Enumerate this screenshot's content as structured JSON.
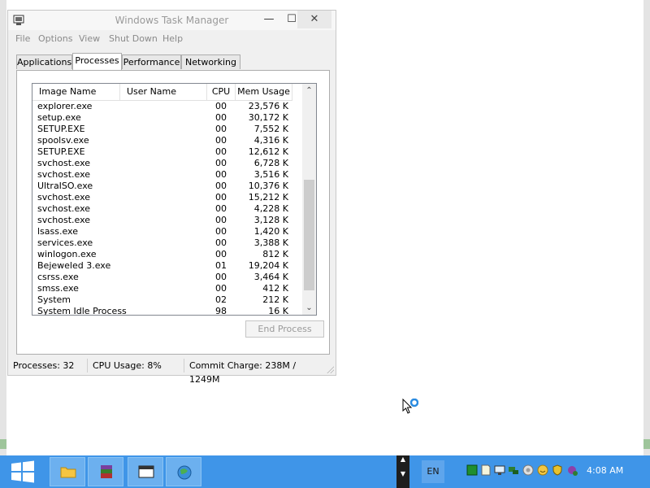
{
  "window": {
    "title": "Windows Task Manager",
    "controls": {
      "minimize": "—",
      "maximize": "☐",
      "close": "✕"
    }
  },
  "menu": [
    "File",
    "Options",
    "View",
    "Shut Down",
    "Help"
  ],
  "tabs": [
    {
      "label": "Applications",
      "active": false
    },
    {
      "label": "Processes",
      "active": true
    },
    {
      "label": "Performance",
      "active": false
    },
    {
      "label": "Networking",
      "active": false
    }
  ],
  "table": {
    "headers": {
      "name": "Image Name",
      "user": "User Name",
      "cpu": "CPU",
      "mem": "Mem Usage"
    },
    "rows": [
      {
        "name": "explorer.exe",
        "user": "",
        "cpu": "00",
        "mem": "23,576 K"
      },
      {
        "name": "setup.exe",
        "user": "",
        "cpu": "00",
        "mem": "30,172 K"
      },
      {
        "name": "SETUP.EXE",
        "user": "",
        "cpu": "00",
        "mem": "7,552 K"
      },
      {
        "name": "spoolsv.exe",
        "user": "",
        "cpu": "00",
        "mem": "4,316 K"
      },
      {
        "name": "SETUP.EXE",
        "user": "",
        "cpu": "00",
        "mem": "12,612 K"
      },
      {
        "name": "svchost.exe",
        "user": "",
        "cpu": "00",
        "mem": "6,728 K"
      },
      {
        "name": "svchost.exe",
        "user": "",
        "cpu": "00",
        "mem": "3,516 K"
      },
      {
        "name": "UltraISO.exe",
        "user": "",
        "cpu": "00",
        "mem": "10,376 K"
      },
      {
        "name": "svchost.exe",
        "user": "",
        "cpu": "00",
        "mem": "15,212 K"
      },
      {
        "name": "svchost.exe",
        "user": "",
        "cpu": "00",
        "mem": "4,228 K"
      },
      {
        "name": "svchost.exe",
        "user": "",
        "cpu": "00",
        "mem": "3,128 K"
      },
      {
        "name": "lsass.exe",
        "user": "",
        "cpu": "00",
        "mem": "1,420 K"
      },
      {
        "name": "services.exe",
        "user": "",
        "cpu": "00",
        "mem": "3,388 K"
      },
      {
        "name": "winlogon.exe",
        "user": "",
        "cpu": "00",
        "mem": "812 K"
      },
      {
        "name": "Bejeweled 3.exe",
        "user": "",
        "cpu": "01",
        "mem": "19,204 K"
      },
      {
        "name": "csrss.exe",
        "user": "",
        "cpu": "00",
        "mem": "3,464 K"
      },
      {
        "name": "smss.exe",
        "user": "",
        "cpu": "00",
        "mem": "412 K"
      },
      {
        "name": "System",
        "user": "",
        "cpu": "02",
        "mem": "212 K"
      },
      {
        "name": "System Idle Process",
        "user": "",
        "cpu": "98",
        "mem": "16 K"
      }
    ]
  },
  "buttons": {
    "end_process": "End Process"
  },
  "status": {
    "processes": "Processes: 32",
    "cpu": "CPU Usage: 8%",
    "commit": "Commit Charge: 238M / 1249M"
  },
  "taskbar": {
    "language": "EN",
    "clock": "4:08 AM",
    "pinned": [
      "folder-icon",
      "winrar-icon",
      "task-manager-icon",
      "network-globe-icon"
    ],
    "tray": [
      "green-square-icon",
      "note-icon",
      "display-icon",
      "network-icon",
      "speaker-icon",
      "smiley-icon",
      "shield-icon",
      "bug-icon"
    ]
  },
  "colors": {
    "taskbar": "#3f95e8",
    "window_bg": "#f0f0f0",
    "disabled_text": "#9a9a9a"
  }
}
